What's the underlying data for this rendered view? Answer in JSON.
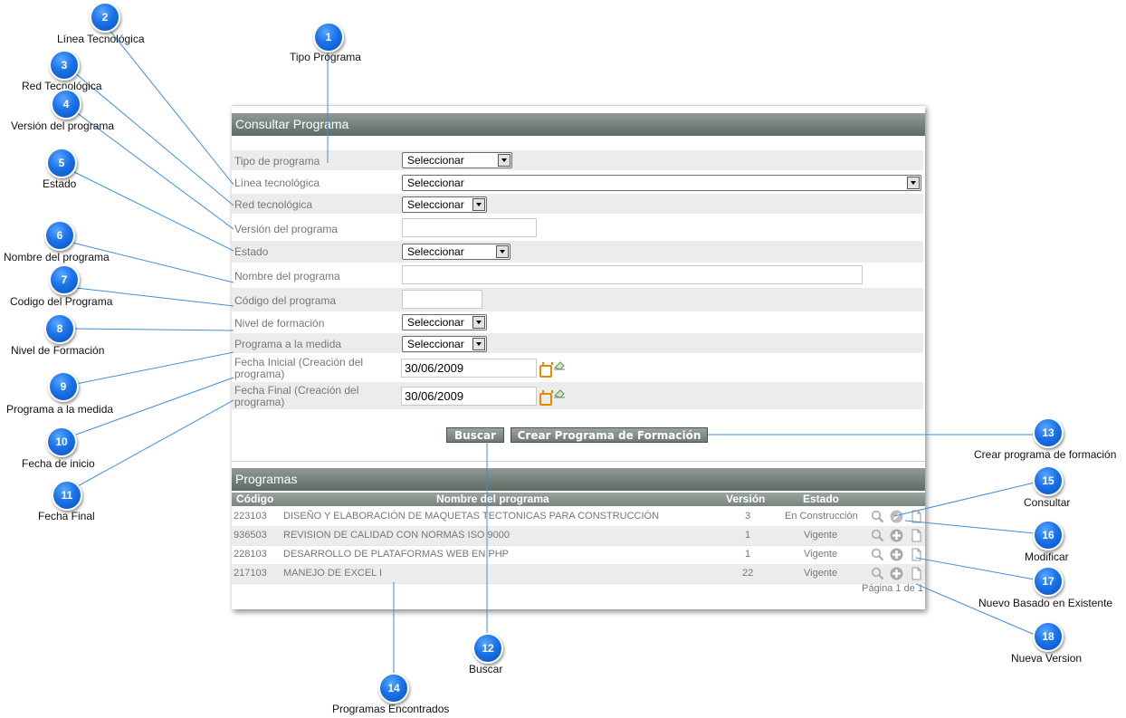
{
  "form": {
    "title": "Consultar Programa",
    "fields": {
      "tipo_programa": {
        "label": "Tipo de programa",
        "value": "Seleccionar"
      },
      "linea_tecnologica": {
        "label": "Línea tecnológica",
        "value": "Seleccionar"
      },
      "red_tecnologica": {
        "label": "Red tecnológica",
        "value": "Seleccionar"
      },
      "version_programa": {
        "label": "Versión del programa",
        "value": ""
      },
      "estado": {
        "label": "Estado",
        "value": "Seleccionar"
      },
      "nombre_programa": {
        "label": "Nombre del programa",
        "value": ""
      },
      "codigo_programa": {
        "label": "Código del programa",
        "value": ""
      },
      "nivel_formacion": {
        "label": "Nivel de formación",
        "value": "Seleccionar"
      },
      "programa_medida": {
        "label": "Programa a la medida",
        "value": "Seleccionar"
      },
      "fecha_inicial": {
        "label": "Fecha Inicial (Creación del programa)",
        "value": "30/06/2009"
      },
      "fecha_final": {
        "label": "Fecha Final (Creación del programa)",
        "value": "30/06/2009"
      }
    },
    "buttons": {
      "buscar": "Buscar",
      "crear": "Crear Programa de Formación"
    }
  },
  "results": {
    "title": "Programas",
    "columns": {
      "codigo": "Código",
      "nombre": "Nombre del programa",
      "version": "Versión",
      "estado": "Estado"
    },
    "rows": [
      {
        "codigo": "223103",
        "nombre": "DISEÑO Y ELABORACIÓN DE MAQUETAS TECTONICAS PARA CONSTRUCCIÓN",
        "version": "3",
        "estado": "En Construcción",
        "action": "edit-icon"
      },
      {
        "codigo": "936503",
        "nombre": "REVISION DE CALIDAD CON NORMAS ISO 9000",
        "version": "1",
        "estado": "Vigente",
        "action": "plus-icon"
      },
      {
        "codigo": "228103",
        "nombre": "DESARROLLO DE PLATAFORMAS WEB EN PHP",
        "version": "1",
        "estado": "Vigente",
        "action": "plus-icon"
      },
      {
        "codigo": "217103",
        "nombre": "MANEJO DE EXCEL I",
        "version": "22",
        "estado": "Vigente",
        "action": "plus-icon"
      }
    ],
    "pager": "Página 1 de 1"
  },
  "callouts": [
    {
      "n": "1",
      "label": "Tipo Programa"
    },
    {
      "n": "2",
      "label": "Línea Tecnológica"
    },
    {
      "n": "3",
      "label": "Red Tecnológica"
    },
    {
      "n": "4",
      "label": "Versión del programa"
    },
    {
      "n": "5",
      "label": "Estado"
    },
    {
      "n": "6",
      "label": "Nombre del programa"
    },
    {
      "n": "7",
      "label": "Codigo del Programa"
    },
    {
      "n": "8",
      "label": "Nivel de Formación"
    },
    {
      "n": "9",
      "label": "Programa a la medida"
    },
    {
      "n": "10",
      "label": "Fecha de inicio"
    },
    {
      "n": "11",
      "label": "Fecha Final"
    },
    {
      "n": "12",
      "label": "Buscar"
    },
    {
      "n": "13",
      "label": "Crear programa de formación"
    },
    {
      "n": "14",
      "label": "Programas Encontrados"
    },
    {
      "n": "15",
      "label": "Consultar"
    },
    {
      "n": "16",
      "label": "Modificar"
    },
    {
      "n": "17",
      "label": "Nuevo Basado en Existente"
    },
    {
      "n": "18",
      "label": "Nueva Version"
    }
  ],
  "colors": {
    "header": "#5d6a62",
    "badge": "#1a73e8",
    "leader": "#3f8fdc",
    "calendar": "#e58a00"
  }
}
